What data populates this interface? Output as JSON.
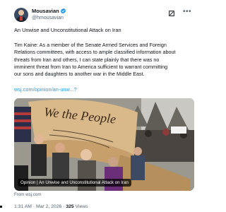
{
  "author": {
    "display_name": "Mousavian",
    "handle": "@hmousavian"
  },
  "post": {
    "title": "An Unwise and Unconstitutional Attack on Iran",
    "body_lines": [
      "Tim Kaine: As a member of the Senate Armed Services and Foreign",
      "Relations committees, with access to ample classified information about",
      "threats from Iran and others, I can state plainly that there was no",
      "imminent threat from Iran to America sufficient to warrant committing",
      "our sons and daughters to another war in the Middle East."
    ],
    "link_text": "wsj.com/opinion/an-unw...?"
  },
  "media": {
    "caption": "Opinion | An Unwise and Unconstitutional Attack on Iran",
    "source": "From wsj.com",
    "banner_text": "We the People"
  },
  "meta": {
    "time": "1:31 AM",
    "date": "Mar 2, 2026",
    "separator": "·",
    "views_count": "325",
    "views_label": "Views"
  },
  "icons": {
    "verified": "verified-badge-icon",
    "grok": "grok-icon",
    "more": "more-options-icon"
  },
  "colors": {
    "link": "#1d9bf0",
    "verified": "#1d9bf0",
    "text": "#0f1419",
    "secondary_text": "#536471"
  }
}
